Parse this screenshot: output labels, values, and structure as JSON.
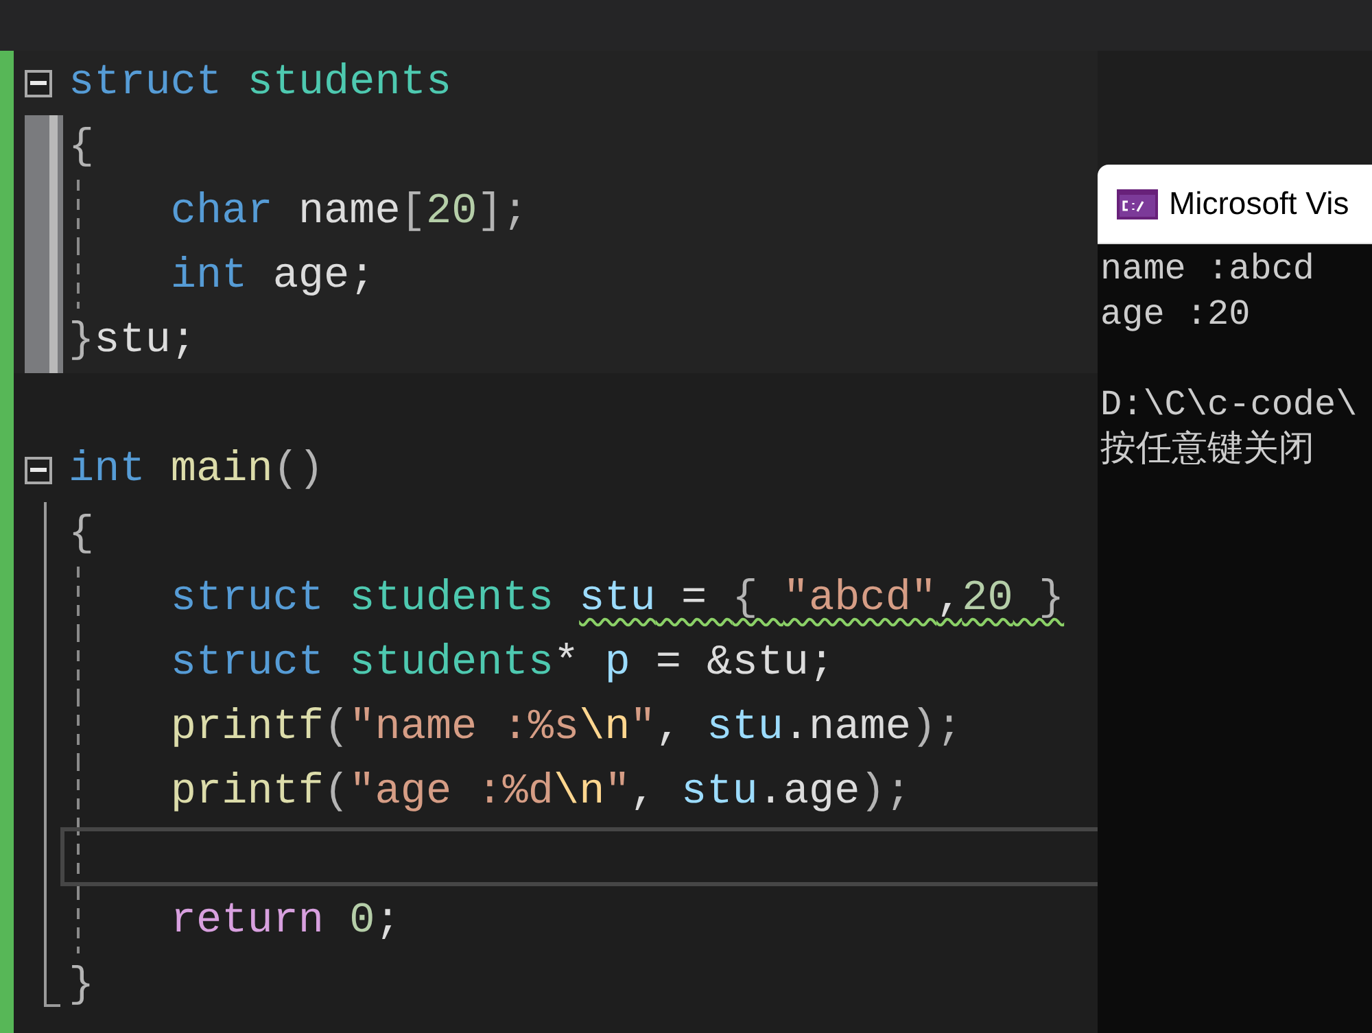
{
  "editor": {
    "blocks": [
      {
        "kind": "highlighted",
        "lines": [
          {
            "kind": "code",
            "tokens": [
              {
                "kind": "keyword",
                "text": "struct ",
                "warning": false
              },
              {
                "kind": "type",
                "text": "students",
                "warning": false
              }
            ]
          },
          {
            "kind": "code",
            "tokens": [
              {
                "kind": "punct",
                "text": "{",
                "warning": false
              }
            ]
          },
          {
            "kind": "code",
            "tokens": [
              {
                "kind": "keyword",
                "text": "    char ",
                "warning": false
              },
              {
                "kind": "plain",
                "text": "name",
                "warning": false
              },
              {
                "kind": "punct",
                "text": "[",
                "warning": false
              },
              {
                "kind": "number",
                "text": "20",
                "warning": false
              },
              {
                "kind": "punct",
                "text": "];",
                "warning": false
              }
            ]
          },
          {
            "kind": "code",
            "tokens": [
              {
                "kind": "keyword",
                "text": "    int ",
                "warning": false
              },
              {
                "kind": "plain",
                "text": "age;",
                "warning": false
              }
            ]
          },
          {
            "kind": "code",
            "tokens": [
              {
                "kind": "punct",
                "text": "}",
                "warning": false
              },
              {
                "kind": "plain",
                "text": "stu;",
                "warning": false
              }
            ]
          }
        ]
      },
      {
        "kind": "plain",
        "lines": [
          {
            "kind": "code",
            "tokens": [
              {
                "kind": "keyword",
                "text": "int ",
                "warning": false
              },
              {
                "kind": "function",
                "text": "main",
                "warning": false
              },
              {
                "kind": "punct",
                "text": "()",
                "warning": false
              }
            ]
          },
          {
            "kind": "code",
            "tokens": [
              {
                "kind": "punct",
                "text": "{",
                "warning": false
              }
            ]
          },
          {
            "kind": "code",
            "tokens": [
              {
                "kind": "keyword",
                "text": "    struct ",
                "warning": false
              },
              {
                "kind": "type",
                "text": "students ",
                "warning": false
              },
              {
                "kind": "variable",
                "text": "stu",
                "warning": true
              },
              {
                "kind": "plain",
                "text": " = ",
                "warning": true
              },
              {
                "kind": "punct",
                "text": "{ ",
                "warning": true
              },
              {
                "kind": "string",
                "text": "\"abcd\"",
                "warning": true
              },
              {
                "kind": "plain",
                "text": ",",
                "warning": true
              },
              {
                "kind": "number",
                "text": "20",
                "warning": true
              },
              {
                "kind": "punct",
                "text": " }",
                "warning": true
              }
            ]
          },
          {
            "kind": "code",
            "tokens": [
              {
                "kind": "keyword",
                "text": "    struct ",
                "warning": false
              },
              {
                "kind": "type",
                "text": "students",
                "warning": false
              },
              {
                "kind": "plain",
                "text": "* ",
                "warning": false
              },
              {
                "kind": "variable",
                "text": "p",
                "warning": false
              },
              {
                "kind": "plain",
                "text": " = &stu;",
                "warning": false
              }
            ]
          },
          {
            "kind": "code",
            "tokens": [
              {
                "kind": "function",
                "text": "    printf",
                "warning": false
              },
              {
                "kind": "punct",
                "text": "(",
                "warning": false
              },
              {
                "kind": "string",
                "text": "\"name :%s",
                "warning": false
              },
              {
                "kind": "escape",
                "text": "\\n",
                "warning": false
              },
              {
                "kind": "string",
                "text": "\"",
                "warning": false
              },
              {
                "kind": "plain",
                "text": ", ",
                "warning": false
              },
              {
                "kind": "variable",
                "text": "stu",
                "warning": false
              },
              {
                "kind": "plain",
                "text": ".name",
                "warning": false
              },
              {
                "kind": "punct",
                "text": ");",
                "warning": false
              }
            ]
          },
          {
            "kind": "code",
            "tokens": [
              {
                "kind": "function",
                "text": "    printf",
                "warning": false
              },
              {
                "kind": "punct",
                "text": "(",
                "warning": false
              },
              {
                "kind": "string",
                "text": "\"age :%d",
                "warning": false
              },
              {
                "kind": "escape",
                "text": "\\n",
                "warning": false
              },
              {
                "kind": "string",
                "text": "\"",
                "warning": false
              },
              {
                "kind": "plain",
                "text": ", ",
                "warning": false
              },
              {
                "kind": "variable",
                "text": "stu",
                "warning": false
              },
              {
                "kind": "plain",
                "text": ".age",
                "warning": false
              },
              {
                "kind": "punct",
                "text": ");",
                "warning": false
              }
            ]
          },
          {
            "kind": "current"
          },
          {
            "kind": "code",
            "tokens": [
              {
                "kind": "control",
                "text": "    return ",
                "warning": false
              },
              {
                "kind": "number",
                "text": "0",
                "warning": false
              },
              {
                "kind": "plain",
                "text": ";",
                "warning": false
              }
            ]
          },
          {
            "kind": "code",
            "tokens": [
              {
                "kind": "punct",
                "text": "}",
                "warning": false
              }
            ]
          }
        ]
      }
    ]
  },
  "console": {
    "title": "Microsoft Vis",
    "lines": [
      "name :abcd",
      "age :20",
      "D:\\C\\c-code\\",
      "按任意键关闭"
    ]
  }
}
